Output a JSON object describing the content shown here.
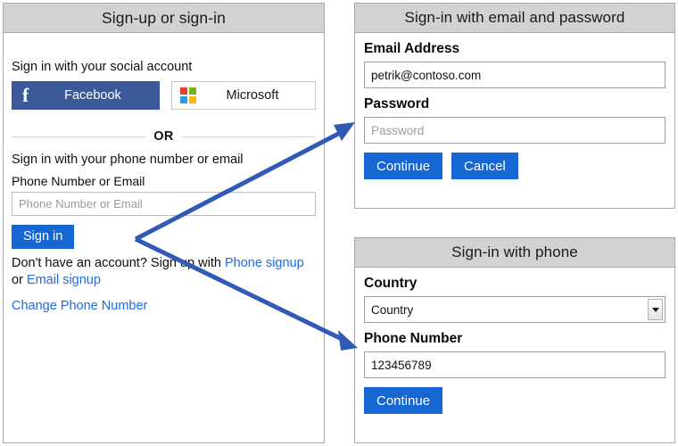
{
  "colors": {
    "accent_blue": "#1667d3",
    "link_blue": "#1f6ae2",
    "facebook_blue": "#3b5998",
    "header_gray": "#d2d2d2",
    "arrow_blue": "#2f5ab5",
    "ms_red": "#e8422b",
    "ms_green": "#7ab41d",
    "ms_blue": "#2aa0e8",
    "ms_yellow": "#f9b718"
  },
  "signup_panel": {
    "title": "Sign-up or sign-in",
    "social_label": "Sign in with your social account",
    "facebook_button": "Facebook",
    "microsoft_button": "Microsoft",
    "or_text": "OR",
    "phone_intro": "Sign in with your phone number or email",
    "phone_field_label": "Phone Number or Email",
    "phone_field_placeholder": "Phone Number or Email",
    "phone_field_value": "",
    "signin_button": "Sign in",
    "signup_prefix": "Don't have an account? Sign up with ",
    "phone_signup_link": "Phone signup",
    "signup_or": " or ",
    "email_signup_link": "Email signup",
    "change_phone_link": "Change Phone Number"
  },
  "email_panel": {
    "title": "Sign-in with email and password",
    "email_label": "Email Address",
    "email_value": "petrik@contoso.com",
    "email_placeholder": "Email Address",
    "password_label": "Password",
    "password_value": "",
    "password_placeholder": "Password",
    "continue_button": "Continue",
    "cancel_button": "Cancel"
  },
  "phone_panel": {
    "title": "Sign-in with phone",
    "country_label": "Country",
    "country_selected": "Country",
    "phone_label": "Phone Number",
    "phone_value": "123456789",
    "phone_placeholder": "Phone Number",
    "continue_button": "Continue"
  },
  "annotations": {
    "arrow_to_password": "arrow-pointing-to-password-field",
    "arrow_to_phone": "arrow-pointing-to-phone-number-field"
  }
}
